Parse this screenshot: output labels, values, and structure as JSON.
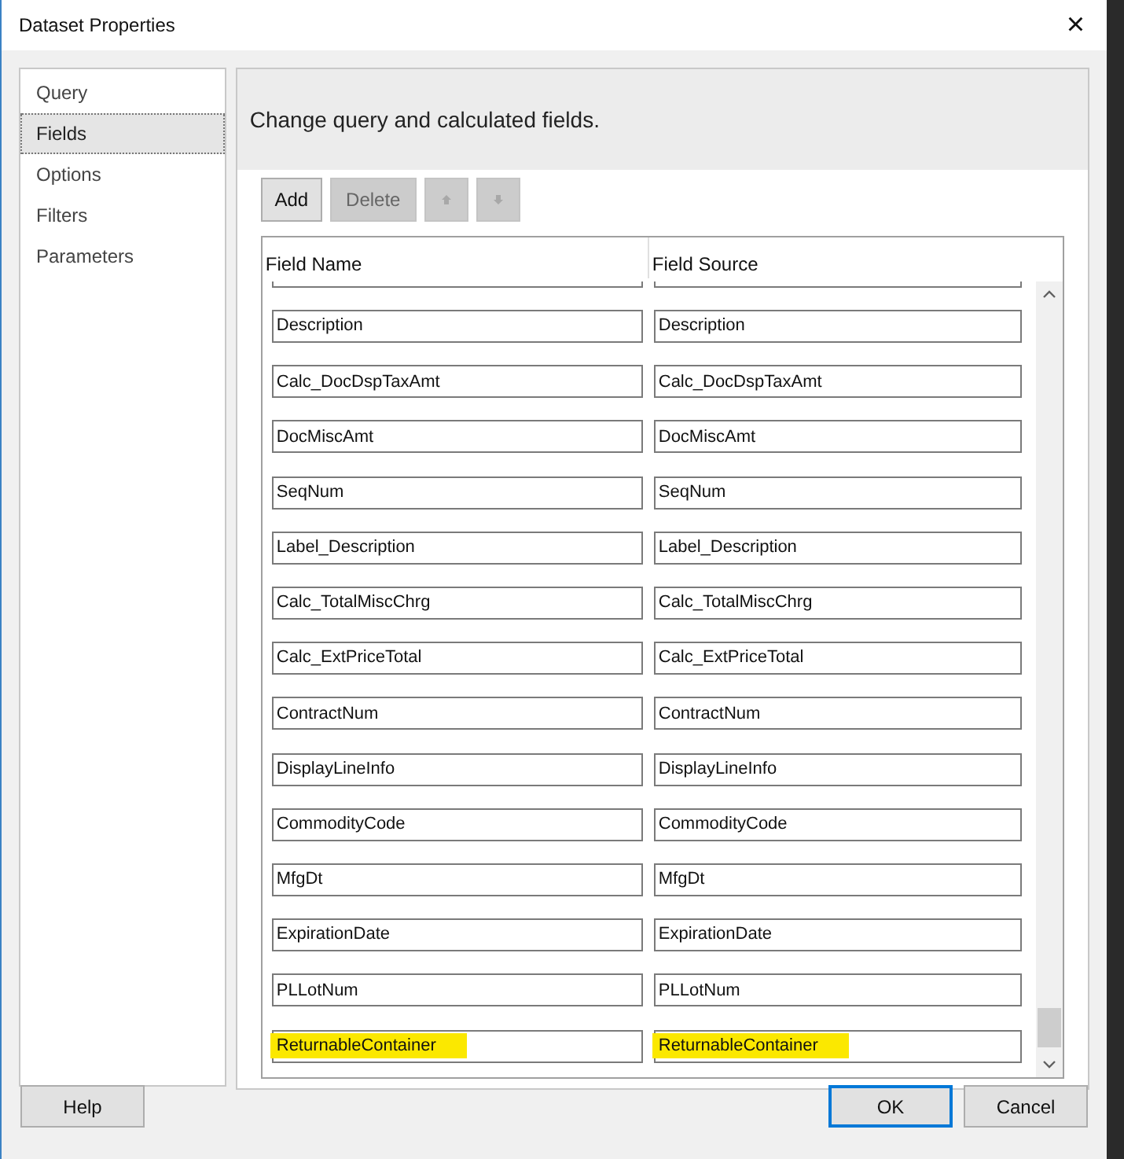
{
  "window": {
    "title": "Dataset Properties",
    "close": "×"
  },
  "sidebar": {
    "items": [
      {
        "label": "Query",
        "selected": false
      },
      {
        "label": "Fields",
        "selected": true
      },
      {
        "label": "Options",
        "selected": false
      },
      {
        "label": "Filters",
        "selected": false
      },
      {
        "label": "Parameters",
        "selected": false
      }
    ]
  },
  "header": "Change query and calculated fields.",
  "toolbar": [
    {
      "kind": "text",
      "label": "Add",
      "disabled": false
    },
    {
      "kind": "text",
      "label": "Delete",
      "disabled": true
    },
    {
      "kind": "up",
      "disabled": true
    },
    {
      "kind": "down",
      "disabled": true
    }
  ],
  "grid": {
    "columns": [
      "Field Name",
      "Field Source"
    ],
    "clipped_top_row": true,
    "rows": [
      {
        "name": "Description",
        "source": "Description",
        "highlighted": false
      },
      {
        "name": "Calc_DocDspTaxAmt",
        "source": "Calc_DocDspTaxAmt",
        "highlighted": false
      },
      {
        "name": "DocMiscAmt",
        "source": "DocMiscAmt",
        "highlighted": false
      },
      {
        "name": "SeqNum",
        "source": "SeqNum",
        "highlighted": false
      },
      {
        "name": "Label_Description",
        "source": "Label_Description",
        "highlighted": false
      },
      {
        "name": "Calc_TotalMiscChrg",
        "source": "Calc_TotalMiscChrg",
        "highlighted": false
      },
      {
        "name": "Calc_ExtPriceTotal",
        "source": "Calc_ExtPriceTotal",
        "highlighted": false
      },
      {
        "name": "ContractNum",
        "source": "ContractNum",
        "highlighted": false
      },
      {
        "name": "DisplayLineInfo",
        "source": "DisplayLineInfo",
        "highlighted": false
      },
      {
        "name": "CommodityCode",
        "source": "CommodityCode",
        "highlighted": false
      },
      {
        "name": "MfgDt",
        "source": "MfgDt",
        "highlighted": false
      },
      {
        "name": "ExpirationDate",
        "source": "ExpirationDate",
        "highlighted": false
      },
      {
        "name": "PLLotNum",
        "source": "PLLotNum",
        "highlighted": false
      },
      {
        "name": "ReturnableContainer",
        "source": "ReturnableContainer",
        "highlighted": true
      }
    ]
  },
  "buttons": [
    {
      "label": "Help",
      "default": false
    },
    {
      "label": "OK",
      "default": true
    },
    {
      "label": "Cancel",
      "default": false
    }
  ]
}
